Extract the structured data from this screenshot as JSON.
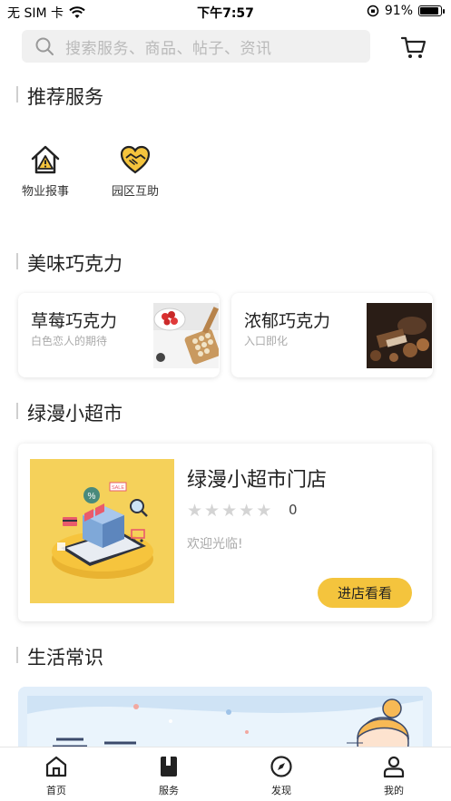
{
  "status_bar": {
    "carrier": "无 SIM 卡",
    "time": "下午7:57",
    "battery": "91%",
    "battery_level": 0.91
  },
  "search": {
    "placeholder": "搜索服务、商品、帖子、资讯"
  },
  "sections": {
    "recommended": "推荐服务",
    "chocolate": "美味巧克力",
    "store": "绿漫小超市",
    "life": "生活常识"
  },
  "services": [
    {
      "label": "物业报事",
      "icon": "house-alert-icon"
    },
    {
      "label": "园区互助",
      "icon": "heart-handshake-icon"
    }
  ],
  "chocolates": [
    {
      "name": "草莓巧克力",
      "subtitle": "白色恋人的期待"
    },
    {
      "name": "浓郁巧克力",
      "subtitle": "入口即化"
    }
  ],
  "store": {
    "name": "绿漫小超市门店",
    "rating": "0",
    "stars_total": 5,
    "welcome": "欢迎光临!",
    "enter_button": "进店看看"
  },
  "colors": {
    "accent": "#f4c43d",
    "brand_yellow": "#f5d15a"
  },
  "tabbar": [
    {
      "label": "首页",
      "icon": "home-icon"
    },
    {
      "label": "服务",
      "icon": "book-icon"
    },
    {
      "label": "发现",
      "icon": "compass-icon"
    },
    {
      "label": "我的",
      "icon": "user-icon"
    }
  ]
}
